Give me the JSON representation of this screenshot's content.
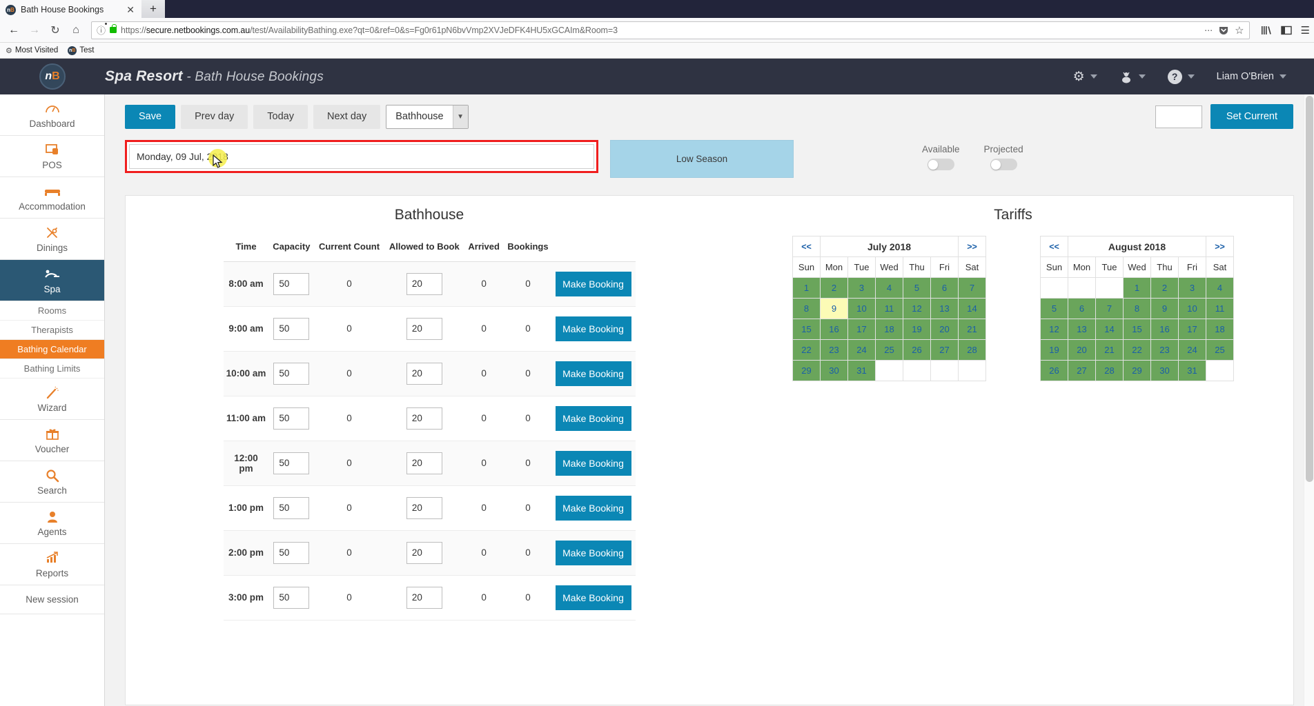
{
  "browser": {
    "tab": {
      "title": "Bath House Bookings",
      "favicon_text": "nB",
      "close_icon": "✕"
    },
    "new_tab_icon": "+",
    "nav": {
      "back_icon": "←",
      "forward_icon": "→",
      "reload_icon": "↻",
      "home_icon": "⌂",
      "url": "https://secure.netbookings.com.au/test/AvailabilityBathing.exe?qt=0&ref=0&s=Fg0r61pN6bvVmp2XVJeDFK4HU5xGCAIm&Room=3",
      "url_domain": "secure.netbookings.com.au",
      "url_prefix": "https://",
      "url_suffix": "/test/AvailabilityBathing.exe?qt=0&ref=0&s=Fg0r61pN6bvVmp2XVJeDFK4HU5xGCAIm&Room=3",
      "page_actions_icon": "⋯",
      "pocket_icon": "pocket-shield",
      "bookmark_star_icon": "☆",
      "library_icon": "library",
      "sidebar_icon": "sidebar",
      "menu_icon": "☰"
    },
    "bookmarks": [
      {
        "label": "Most Visited",
        "icon": "gear-icon"
      },
      {
        "label": "Test",
        "icon": "nb-favicon"
      }
    ]
  },
  "header": {
    "logo_text": "nB",
    "title_main": "Spa Resort",
    "title_sep": " - ",
    "title_sub": "Bath House Bookings",
    "gear_icon": "⚙",
    "user_icon": "♟",
    "help_icon": "?",
    "username": "Liam O'Brien"
  },
  "sidebar": {
    "items": [
      {
        "label": "Dashboard",
        "icon": "◔",
        "active": false
      },
      {
        "label": "POS",
        "icon": "▣",
        "active": false
      },
      {
        "label": "Accommodation",
        "icon": "▬",
        "active": false
      },
      {
        "label": "Dinings",
        "icon": "✂",
        "active": false
      },
      {
        "label": "Spa",
        "icon": "♒",
        "active": true
      }
    ],
    "sub_items": [
      {
        "label": "Rooms",
        "active": false
      },
      {
        "label": "Therapists",
        "active": false
      },
      {
        "label": "Bathing Calendar",
        "active": true
      },
      {
        "label": "Bathing Limits",
        "active": false
      }
    ],
    "items2": [
      {
        "label": "Wizard",
        "icon": "✦"
      },
      {
        "label": "Voucher",
        "icon": "Ἰ1"
      },
      {
        "label": "Search",
        "icon": "⚲"
      },
      {
        "label": "Agents",
        "icon": "☺"
      },
      {
        "label": "Reports",
        "icon": "↗"
      }
    ],
    "new_session": "New session"
  },
  "toolbar": {
    "save_label": "Save",
    "prev_day_label": "Prev day",
    "today_label": "Today",
    "next_day_label": "Next day",
    "venue_selected": "Bathhouse",
    "venue_caret": "⌄",
    "current_value": "",
    "set_current_label": "Set Current"
  },
  "date_row": {
    "date_value": "Monday, 09 Jul, 2018",
    "season_label": "Low Season",
    "available_label": "Available",
    "projected_label": "Projected",
    "available_on": false,
    "projected_on": false,
    "highlight_color": "#f01e1e"
  },
  "bathhouse": {
    "title": "Bathhouse",
    "columns": [
      "Time",
      "Capacity",
      "Current Count",
      "Allowed to Book",
      "Arrived",
      "Bookings",
      ""
    ],
    "make_booking_label": "Make Booking",
    "rows": [
      {
        "time": "8:00 am",
        "capacity": "50",
        "current_count": "0",
        "allowed_to_book": "20",
        "arrived": "0",
        "bookings": "0"
      },
      {
        "time": "9:00 am",
        "capacity": "50",
        "current_count": "0",
        "allowed_to_book": "20",
        "arrived": "0",
        "bookings": "0"
      },
      {
        "time": "10:00 am",
        "capacity": "50",
        "current_count": "0",
        "allowed_to_book": "20",
        "arrived": "0",
        "bookings": "0"
      },
      {
        "time": "11:00 am",
        "capacity": "50",
        "current_count": "0",
        "allowed_to_book": "20",
        "arrived": "0",
        "bookings": "0"
      },
      {
        "time": "12:00 pm",
        "capacity": "50",
        "current_count": "0",
        "allowed_to_book": "20",
        "arrived": "0",
        "bookings": "0"
      },
      {
        "time": "1:00 pm",
        "capacity": "50",
        "current_count": "0",
        "allowed_to_book": "20",
        "arrived": "0",
        "bookings": "0"
      },
      {
        "time": "2:00 pm",
        "capacity": "50",
        "current_count": "0",
        "allowed_to_book": "20",
        "arrived": "0",
        "bookings": "0"
      },
      {
        "time": "3:00 pm",
        "capacity": "50",
        "current_count": "0",
        "allowed_to_book": "20",
        "arrived": "0",
        "bookings": "0"
      }
    ]
  },
  "tariffs": {
    "title": "Tariffs",
    "prev_icon": "<<",
    "next_icon": ">>",
    "dow": [
      "Sun",
      "Mon",
      "Tue",
      "Wed",
      "Thu",
      "Fri",
      "Sat"
    ],
    "available_color": "#6aa55b",
    "selected_color": "#fcfbb6",
    "calendars": [
      {
        "month_label": "July 2018",
        "weeks": [
          [
            {
              "d": "1",
              "s": "day"
            },
            {
              "d": "2",
              "s": "day"
            },
            {
              "d": "3",
              "s": "day"
            },
            {
              "d": "4",
              "s": "day"
            },
            {
              "d": "5",
              "s": "day"
            },
            {
              "d": "6",
              "s": "day"
            },
            {
              "d": "7",
              "s": "day"
            }
          ],
          [
            {
              "d": "8",
              "s": "day"
            },
            {
              "d": "9",
              "s": "sel"
            },
            {
              "d": "10",
              "s": "day"
            },
            {
              "d": "11",
              "s": "day"
            },
            {
              "d": "12",
              "s": "day"
            },
            {
              "d": "13",
              "s": "day"
            },
            {
              "d": "14",
              "s": "day"
            }
          ],
          [
            {
              "d": "15",
              "s": "day"
            },
            {
              "d": "16",
              "s": "day"
            },
            {
              "d": "17",
              "s": "day"
            },
            {
              "d": "18",
              "s": "day"
            },
            {
              "d": "19",
              "s": "day"
            },
            {
              "d": "20",
              "s": "day"
            },
            {
              "d": "21",
              "s": "day"
            }
          ],
          [
            {
              "d": "22",
              "s": "day"
            },
            {
              "d": "23",
              "s": "day"
            },
            {
              "d": "24",
              "s": "day"
            },
            {
              "d": "25",
              "s": "day"
            },
            {
              "d": "26",
              "s": "day"
            },
            {
              "d": "27",
              "s": "day"
            },
            {
              "d": "28",
              "s": "day"
            }
          ],
          [
            {
              "d": "29",
              "s": "day"
            },
            {
              "d": "30",
              "s": "day"
            },
            {
              "d": "31",
              "s": "day"
            },
            {
              "d": "",
              "s": "empty"
            },
            {
              "d": "",
              "s": "empty"
            },
            {
              "d": "",
              "s": "empty"
            },
            {
              "d": "",
              "s": "empty"
            }
          ]
        ]
      },
      {
        "month_label": "August 2018",
        "weeks": [
          [
            {
              "d": "",
              "s": "empty"
            },
            {
              "d": "",
              "s": "empty"
            },
            {
              "d": "",
              "s": "empty"
            },
            {
              "d": "1",
              "s": "day"
            },
            {
              "d": "2",
              "s": "day"
            },
            {
              "d": "3",
              "s": "day"
            },
            {
              "d": "4",
              "s": "day"
            }
          ],
          [
            {
              "d": "5",
              "s": "day"
            },
            {
              "d": "6",
              "s": "day"
            },
            {
              "d": "7",
              "s": "day"
            },
            {
              "d": "8",
              "s": "day"
            },
            {
              "d": "9",
              "s": "day"
            },
            {
              "d": "10",
              "s": "day"
            },
            {
              "d": "11",
              "s": "day"
            }
          ],
          [
            {
              "d": "12",
              "s": "day"
            },
            {
              "d": "13",
              "s": "day"
            },
            {
              "d": "14",
              "s": "day"
            },
            {
              "d": "15",
              "s": "day"
            },
            {
              "d": "16",
              "s": "day"
            },
            {
              "d": "17",
              "s": "day"
            },
            {
              "d": "18",
              "s": "day"
            }
          ],
          [
            {
              "d": "19",
              "s": "day"
            },
            {
              "d": "20",
              "s": "day"
            },
            {
              "d": "21",
              "s": "day"
            },
            {
              "d": "22",
              "s": "day"
            },
            {
              "d": "23",
              "s": "day"
            },
            {
              "d": "24",
              "s": "day"
            },
            {
              "d": "25",
              "s": "day"
            }
          ],
          [
            {
              "d": "26",
              "s": "day"
            },
            {
              "d": "27",
              "s": "day"
            },
            {
              "d": "28",
              "s": "day"
            },
            {
              "d": "29",
              "s": "day"
            },
            {
              "d": "30",
              "s": "day"
            },
            {
              "d": "31",
              "s": "day"
            },
            {
              "d": "",
              "s": "empty"
            }
          ]
        ]
      }
    ]
  }
}
